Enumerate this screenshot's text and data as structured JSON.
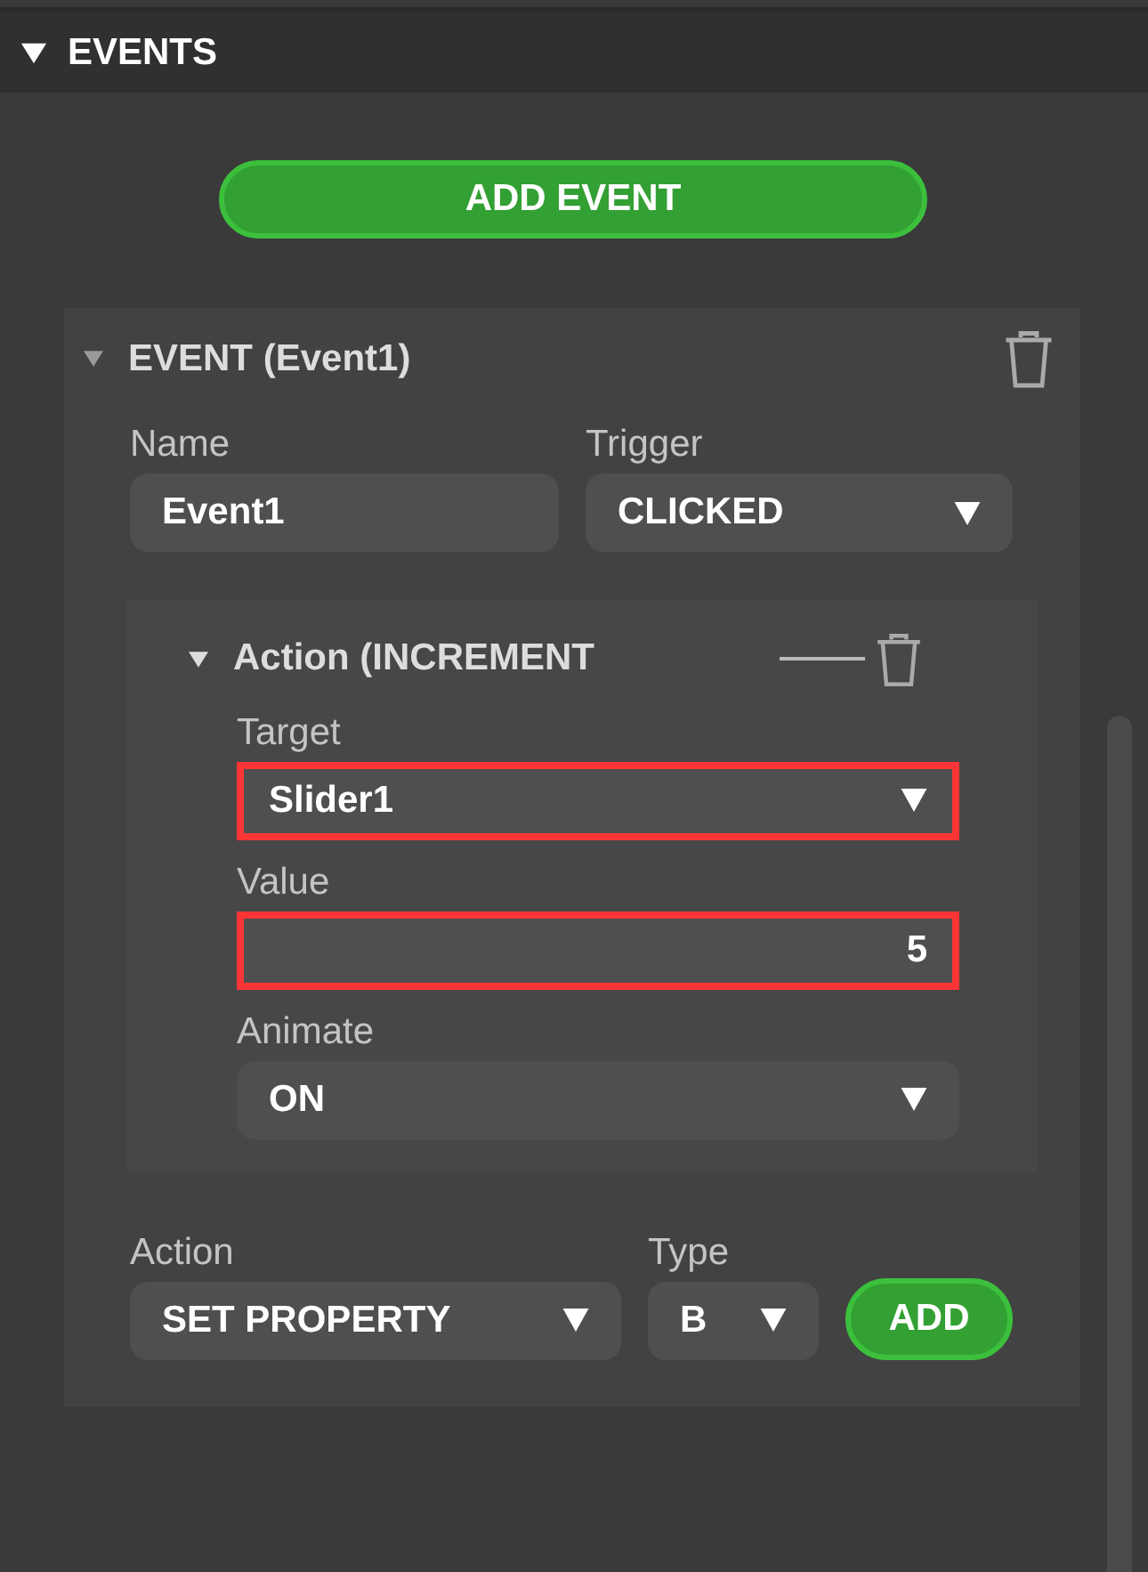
{
  "section": {
    "title": "EVENTS",
    "expanded": true
  },
  "add_event_button": "ADD EVENT",
  "event": {
    "title": "EVENT (Event1)",
    "expanded": true,
    "fields": [
      {
        "kind": "input",
        "label": "Name",
        "value": "Event1"
      },
      {
        "kind": "select",
        "label": "Trigger",
        "value": "CLICKED"
      }
    ],
    "action": {
      "title": "Action (INCREMENT",
      "expanded": true,
      "fields": [
        {
          "kind": "select",
          "label": "Target",
          "value": "Slider1",
          "highlighted": true
        },
        {
          "kind": "number",
          "label": "Value",
          "value": "5",
          "highlighted": true
        },
        {
          "kind": "select",
          "label": "Animate",
          "value": "ON",
          "highlighted": false
        }
      ]
    },
    "new_action": {
      "fields": [
        {
          "kind": "select",
          "label": "Action",
          "value": "SET PROPERTY"
        },
        {
          "kind": "select",
          "label": "Type",
          "value": "B"
        }
      ],
      "add_button": "ADD"
    }
  }
}
